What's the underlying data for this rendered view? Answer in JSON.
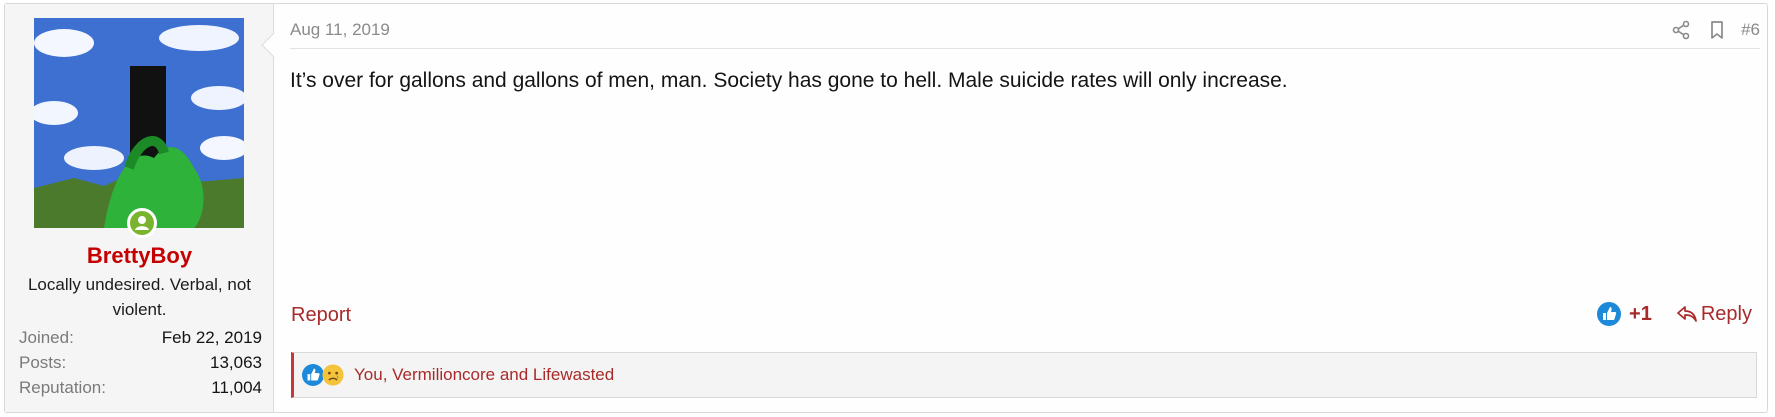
{
  "user": {
    "username": "BrettyBoy",
    "title": "Locally undesired. Verbal, not violent.",
    "extras": [
      {
        "label": "Joined:",
        "value": "Feb 22, 2019"
      },
      {
        "label": "Posts:",
        "value": "13,063"
      },
      {
        "label": "Reputation:",
        "value": "11,004"
      }
    ],
    "avatar_icon": "avatar-image",
    "online_icon": "online-status-icon"
  },
  "post": {
    "date": "Aug 11, 2019",
    "number": "#6",
    "message": "It’s over for gallons and gallons of men, man. Society has gone to hell. Male suicide rates will only increase.",
    "header_icons": [
      "share-icon",
      "bookmark-icon"
    ]
  },
  "footer": {
    "report_label": "Report",
    "like_count": "+1",
    "reply_label": "Reply"
  },
  "reactions": {
    "icons": [
      "like-reaction-icon",
      "sad-reaction-icon"
    ],
    "text": "You, Vermilioncore and Lifewasted"
  },
  "colors": {
    "accent": "#a82a2a",
    "username": "#c40000",
    "like_blue": "#1c8ad9",
    "online_green": "#7ab32e"
  }
}
